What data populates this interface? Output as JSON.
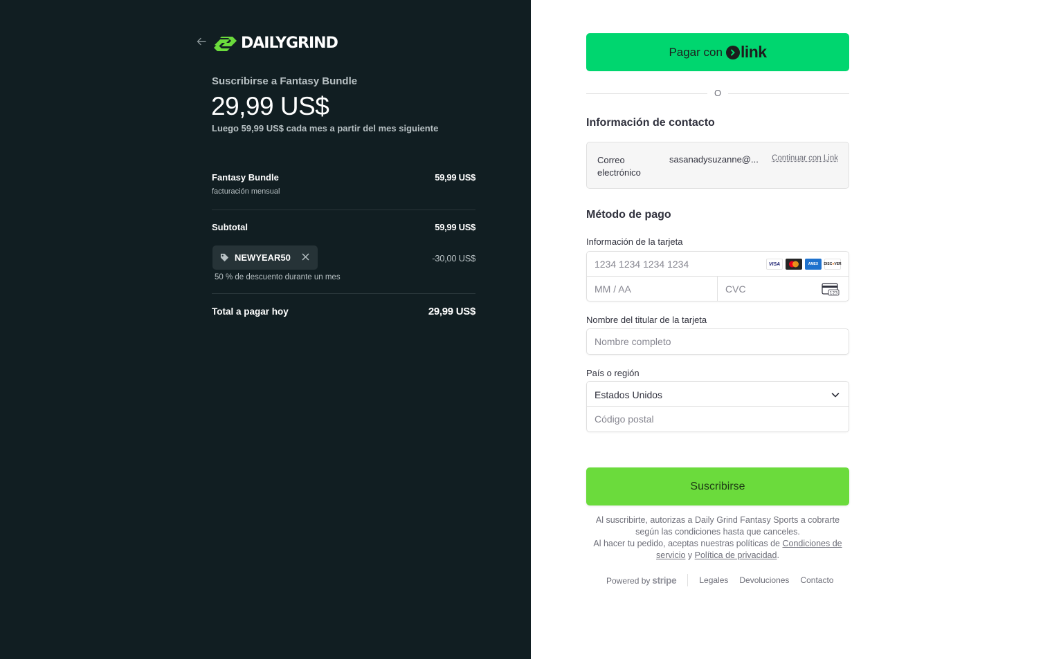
{
  "brand": {
    "name": "DAILYGRIND",
    "accent": "#6bdb3c"
  },
  "summary": {
    "subscribe_label": "Suscribirse a Fantasy Bundle",
    "price": "29,99 US$",
    "after_price": "Luego 59,99 US$ cada mes a partir del mes siguiente",
    "line_item": {
      "name": "Fantasy Bundle",
      "sub": "facturación mensual",
      "amount": "59,99 US$"
    },
    "subtotal": {
      "label": "Subtotal",
      "amount": "59,99 US$"
    },
    "coupon": {
      "code": "NEWYEAR50",
      "discount": "-30,00 US$",
      "note": "50 % de descuento durante un mes"
    },
    "total": {
      "label": "Total a pagar hoy",
      "amount": "29,99 US$"
    }
  },
  "payment": {
    "link_button": {
      "label": "Pagar con",
      "logo_word": "link"
    },
    "or_text": "O",
    "contact": {
      "title": "Información de contacto",
      "email_label": "Correo electrónico",
      "email_value": "sasanadysuzanne@...",
      "continue_link": "Continuar con Link"
    },
    "method": {
      "title": "Método de pago",
      "card_label": "Información de la tarjeta",
      "card_placeholder": "1234 1234 1234 1234",
      "exp_placeholder": "MM / AA",
      "cvc_placeholder": "CVC",
      "brands": [
        "VISA",
        "mastercard",
        "amex",
        "DISCOVER"
      ],
      "holder_label": "Nombre del titular de la tarjeta",
      "holder_placeholder": "Nombre completo",
      "country_label": "País o región",
      "country_value": "Estados Unidos",
      "zip_placeholder": "Código postal"
    },
    "subscribe_button": "Suscribirse",
    "legal": {
      "line1": "Al suscribirte, autorizas a Daily Grind Fantasy Sports a cobrarte según las condiciones hasta que canceles.",
      "line2_prefix": "Al hacer tu pedido, aceptas nuestras políticas de",
      "terms_link": "Condiciones de servicio",
      "and": "y",
      "privacy_link": "Política de privacidad",
      "period": "."
    },
    "footer": {
      "powered_by": "Powered by",
      "stripe": "stripe",
      "links": [
        "Legales",
        "Devoluciones",
        "Contacto"
      ]
    }
  }
}
